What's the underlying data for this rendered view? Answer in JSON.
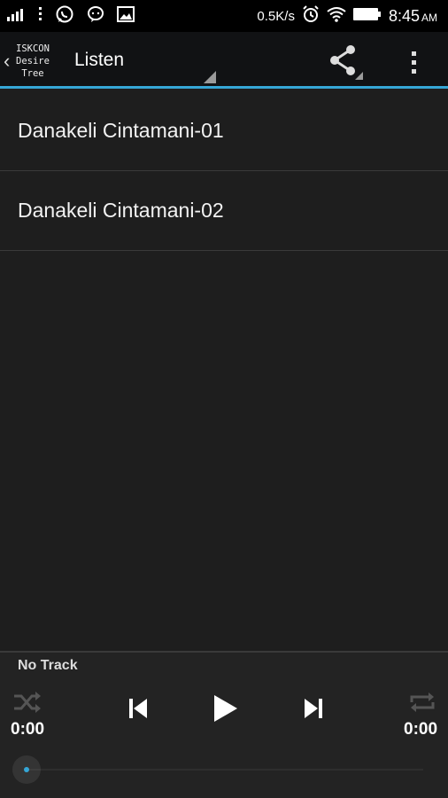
{
  "status_bar": {
    "net_speed": "0.5K/s",
    "time": "8:45",
    "ampm": "AM",
    "icons": [
      "signal-icon",
      "more-dots-icon",
      "whatsapp-icon",
      "messenger-icon",
      "gallery-icon",
      "alarm-icon",
      "wifi-icon",
      "battery-icon"
    ]
  },
  "action_bar": {
    "logo_lines": [
      "ISKCON",
      "Desire",
      "Tree"
    ],
    "title": "Listen",
    "accent": "#35a6d6"
  },
  "tracks": [
    {
      "title": "Danakeli Cintamani-01"
    },
    {
      "title": "Danakeli Cintamani-02"
    }
  ],
  "player": {
    "now_playing": "No Track",
    "elapsed": "0:00",
    "duration": "0:00",
    "progress": 0
  }
}
